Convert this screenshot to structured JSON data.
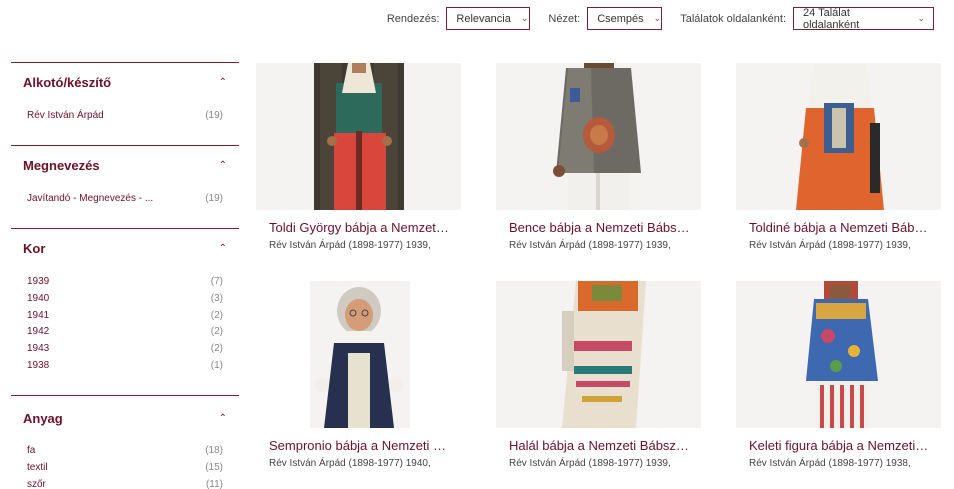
{
  "toolbar": {
    "sort_label": "Rendezés:",
    "sort_value": "Relevancia",
    "view_label": "Nézet:",
    "view_value": "Csempés",
    "perpage_label": "Találatok oldalanként:",
    "perpage_value": "24 Találat oldalanként"
  },
  "facets": [
    {
      "title": "Alkotó/készítő",
      "items": [
        {
          "name": "Rév István Árpád",
          "count": "(19)"
        }
      ]
    },
    {
      "title": "Megnevezés",
      "items": [
        {
          "name": "Javítandó - Megnevezés - ...",
          "count": "(19)"
        }
      ]
    },
    {
      "title": "Kor",
      "items": [
        {
          "name": "1939",
          "count": "(7)"
        },
        {
          "name": "1940",
          "count": "(3)"
        },
        {
          "name": "1941",
          "count": "(2)"
        },
        {
          "name": "1942",
          "count": "(2)"
        },
        {
          "name": "1943",
          "count": "(2)"
        },
        {
          "name": "1938",
          "count": "(1)"
        }
      ]
    },
    {
      "title": "Anyag",
      "items": [
        {
          "name": "fa",
          "count": "(18)"
        },
        {
          "name": "textil",
          "count": "(15)"
        },
        {
          "name": "szőr",
          "count": "(11)"
        }
      ]
    }
  ],
  "results": [
    {
      "title": "Toldi György bábja a Nemzeti Bábszínház",
      "meta": "Rév István Árpád (1898-1977) 1939,",
      "image": "puppet-toldi-gyorgy"
    },
    {
      "title": "Bence bábja a Nemzeti Bábszínház",
      "meta": "Rév István Árpád (1898-1977) 1939,",
      "image": "puppet-bence"
    },
    {
      "title": "Toldiné bábja a Nemzeti Bábszínház",
      "meta": "Rév István Árpád (1898-1977) 1939,",
      "image": "puppet-toldine"
    },
    {
      "title": "Sempronio bábja a Nemzeti Bábszínház",
      "meta": "Rév István Árpád (1898-1977) 1940,",
      "image": "puppet-sempronio"
    },
    {
      "title": "Halál bábja a Nemzeti Bábszínház",
      "meta": "Rév István Árpád (1898-1977) 1939,",
      "image": "puppet-halal"
    },
    {
      "title": "Keleti figura bábja a Nemzeti Bábszínház",
      "meta": "Rév István Árpád (1898-1977) 1938,",
      "image": "puppet-keleti-figura"
    }
  ],
  "colors": {
    "accent": "#6d1028",
    "border": "#7a1f35",
    "thumb_bg": "#f4f3f2"
  }
}
